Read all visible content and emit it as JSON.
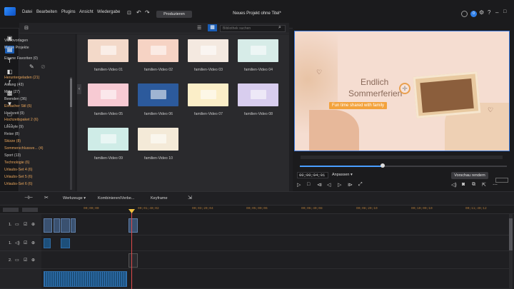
{
  "menu": [
    "Datei",
    "Bearbeiten",
    "Plugins",
    "Ansicht",
    "Wiedergabe"
  ],
  "produce": "Produzieren",
  "title": "Neues Projekt ohne Titel*",
  "notif": "0",
  "library": {
    "search_placeholder": "Bibliothek suchen",
    "top_items": [
      "Videovorlagen",
      "Meine Projekte"
    ],
    "fav": "Eigene Favoriten (0)"
  },
  "categories": [
    {
      "label": "Heruntergeladen (21)",
      "orange": true
    },
    {
      "label": "Anfang (43)",
      "orange": false
    },
    {
      "label": "Mitte (27)",
      "orange": false
    },
    {
      "label": "Beenden (36)",
      "orange": false
    },
    {
      "label": "Einfacher Stil (6)",
      "orange": true
    },
    {
      "label": "Hochzeit (9)",
      "orange": false
    },
    {
      "label": "Hochzeitspaket 2 (6)",
      "orange": true
    },
    {
      "label": "Lifestyle (9)",
      "orange": false
    },
    {
      "label": "Reise (8)",
      "orange": false
    },
    {
      "label": "Skizze (8)",
      "orange": true
    },
    {
      "label": "Sommerschlussve... (4)",
      "orange": true
    },
    {
      "label": "Sport (13)",
      "orange": false
    },
    {
      "label": "Technologie (6)",
      "orange": true
    },
    {
      "label": "Urlaubs-Set 4 (6)",
      "orange": true
    },
    {
      "label": "Urlaubs-Set 5 (6)",
      "orange": true
    },
    {
      "label": "Urlaubs-Set 6 (6)",
      "orange": true
    }
  ],
  "templates": [
    {
      "label": "familien-Video 01",
      "color": "#f3d9c9"
    },
    {
      "label": "familien-Video 02",
      "color": "#f6d3c4"
    },
    {
      "label": "familien-Video 03",
      "color": "#f4e9e0"
    },
    {
      "label": "familien-Video 04",
      "color": "#d7ece8"
    },
    {
      "label": "familien-Video 05",
      "color": "#f7cad3"
    },
    {
      "label": "familien-Video 06",
      "color": "#2c5a9c"
    },
    {
      "label": "familien-Video 07",
      "color": "#fbeec8"
    },
    {
      "label": "familien-Video 08",
      "color": "#d8cdee"
    },
    {
      "label": "familien-Video 09",
      "color": "#cfece7"
    },
    {
      "label": "familien-Video 10",
      "color": "#f4ead8"
    }
  ],
  "preview": {
    "line1": "Endlich",
    "line2": "Sommerferien",
    "sub": "Fun time shared with family",
    "timecode": "00;00;04;01",
    "fit": "Anpassen",
    "render": "Vorschau rendern"
  },
  "timeline": {
    "tools": "Werkzeuge",
    "edit": "Kombinieren/Verbe...",
    "keyframe": "Keyframe",
    "ruler": [
      "00;00;00",
      "00;01;40;02",
      "00;03;20;04",
      "00;05;00;06",
      "00;06;40;08",
      "00;08;20;10",
      "00;10;00;10",
      "00;11;40;12"
    ],
    "tracks": [
      "1.",
      "1.",
      "2."
    ]
  }
}
